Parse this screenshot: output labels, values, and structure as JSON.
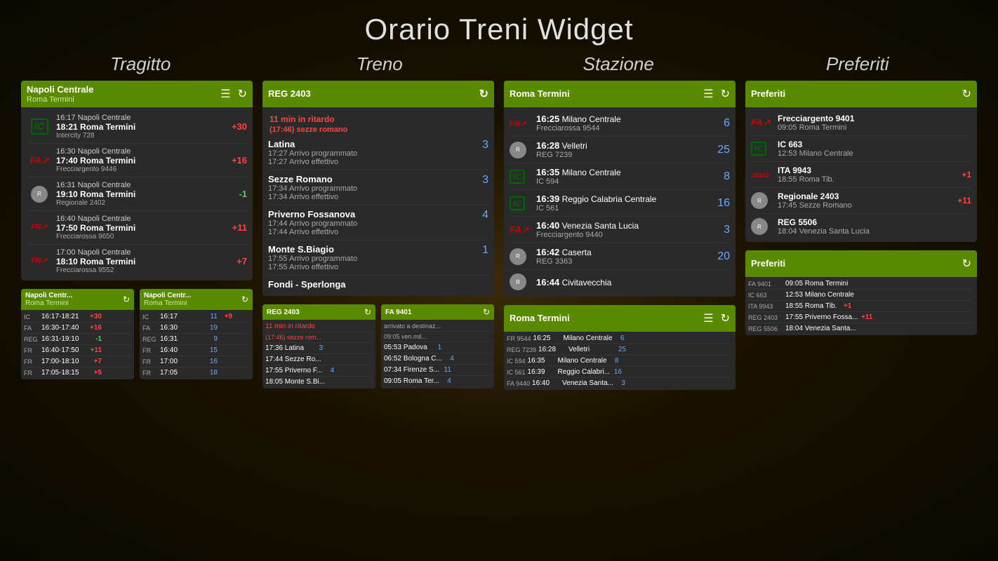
{
  "page": {
    "title": "Orario Treni Widget"
  },
  "columns": [
    {
      "header": "Tragitto"
    },
    {
      "header": "Treno"
    },
    {
      "header": "Stazione"
    },
    {
      "header": "Preferiti"
    }
  ],
  "tragitto": {
    "header": "Napoli Centrale\nRoma Termini",
    "trains": [
      {
        "logo": "IC",
        "from": "16:17 Napoli Centrale",
        "to": "18:21 Roma Termini",
        "name": "Intercity 728",
        "delay": "+30",
        "delayType": "pos"
      },
      {
        "logo": "FA",
        "from": "16:30 Napoli Centrale",
        "to": "17:40 Roma Termini",
        "name": "Frecciargento 9446",
        "delay": "+16",
        "delayType": "pos"
      },
      {
        "logo": "REG",
        "from": "16:31 Napoli Centrale",
        "to": "19:10 Roma Termini",
        "name": "Regionale 2402",
        "delay": "-1",
        "delayType": "neg"
      },
      {
        "logo": "FR",
        "from": "16:40 Napoli Centrale",
        "to": "17:50 Roma Termini",
        "name": "Frecciarossa 9650",
        "delay": "+11",
        "delayType": "pos"
      },
      {
        "logo": "FR",
        "from": "17:00 Napoli Centrale",
        "to": "18:10 Roma Termini",
        "name": "Frecciarossa 9552",
        "delay": "+7",
        "delayType": "pos"
      }
    ]
  },
  "treno": {
    "header": "REG 2403",
    "delay_notice": "11 min in ritardo",
    "delay_detail": "(17:46) sezze romano",
    "stops": [
      {
        "name": "Latina",
        "arr_prog": "17:27 Arrivo programmato",
        "arr_eff": "17:27 Arrivo effettivo",
        "num": "3"
      },
      {
        "name": "Sezze Romano",
        "arr_prog": "17:34 Arrivo programmato",
        "arr_eff": "17:34 Arrivo effettivo",
        "num": "3"
      },
      {
        "name": "Priverno Fossanova",
        "arr_prog": "17:44 Arrivo programmato",
        "arr_eff": "17:44 Arrivo effettivo",
        "num": "4"
      },
      {
        "name": "Monte S.Biagio",
        "arr_prog": "17:55 Arrivo programmato",
        "arr_eff": "17:55 Arrivo effettivo",
        "num": "1"
      },
      {
        "name": "Fondi - Sperlonga",
        "arr_prog": "",
        "arr_eff": "",
        "num": ""
      }
    ]
  },
  "stazione": {
    "header": "Roma Termini",
    "trains": [
      {
        "logo": "FR",
        "time": "16:25",
        "dest": "Milano Centrale",
        "name": "Frecciarossa 9544",
        "num": "6"
      },
      {
        "logo": "REG",
        "time": "16:28",
        "dest": "Velletri",
        "name": "REG 7239",
        "num": "25"
      },
      {
        "logo": "IC",
        "time": "16:35",
        "dest": "Milano Centrale",
        "name": "IC 594",
        "num": "8"
      },
      {
        "logo": "IC",
        "time": "16:39",
        "dest": "Reggio Calabria Centrale",
        "name": "IC 561",
        "num": "16"
      },
      {
        "logo": "FA",
        "time": "16:40",
        "dest": "Venezia Santa Lucia",
        "name": "Frecciargento 9440",
        "num": "3"
      },
      {
        "logo": "REG",
        "time": "16:42",
        "dest": "Caserta",
        "name": "REG 3363",
        "num": "20"
      },
      {
        "logo": "IC",
        "time": "16:44",
        "dest": "Civitavecchia",
        "name": "",
        "num": ""
      }
    ]
  },
  "preferiti": {
    "header": "Preferiti",
    "trains": [
      {
        "logo": "FA",
        "name": "Frecciargento 9401",
        "detail": "09:05 Roma Termini",
        "delay": "",
        "delayType": ""
      },
      {
        "logo": "IC",
        "name": "IC 663",
        "detail": "12:53 Milano Centrale",
        "delay": "",
        "delayType": ""
      },
      {
        "logo": "ITALO",
        "name": "ITA 9943",
        "detail": "18:55 Roma Tib.",
        "delay": "+1",
        "delayType": "pos"
      },
      {
        "logo": "REG",
        "name": "Regionale 2403",
        "detail": "17:45 Sezze Romano",
        "delay": "+11",
        "delayType": "pos"
      },
      {
        "logo": "REG",
        "name": "REG 5506",
        "detail": "18:04 Venezia Santa Lucia",
        "delay": "",
        "delayType": ""
      }
    ]
  },
  "bottom": {
    "tragitto_small1": {
      "header1": "Napoli Centr...",
      "header2": "Roma Termini",
      "rows": [
        {
          "type": "IC",
          "time": "16:17-18:21",
          "delay": "+30",
          "delayType": "pos"
        },
        {
          "type": "FA",
          "time": "16:30-17:40",
          "delay": "+16",
          "delayType": "pos"
        },
        {
          "type": "REG",
          "time": "16:31-19:10",
          "delay": "-1",
          "delayType": "neg"
        },
        {
          "type": "FR",
          "time": "16:40-17:50",
          "delay": "+11",
          "delayType": "pos"
        },
        {
          "type": "FR",
          "time": "17:00-18:10",
          "delay": "+7",
          "delayType": "pos"
        },
        {
          "type": "FR",
          "time": "17:05-18:15",
          "delay": "+5",
          "delayType": "pos"
        }
      ]
    },
    "tragitto_small2": {
      "header1": "Napoli Centr...",
      "header2": "Roma Termini",
      "rows": [
        {
          "type": "IC",
          "time": "16:17",
          "num": "11",
          "delay": "+9",
          "delayType": "pos"
        },
        {
          "type": "FA",
          "time": "16:30",
          "num": "19",
          "delay": "",
          "delayType": ""
        },
        {
          "type": "REG",
          "time": "16:31",
          "num": "9",
          "delay": "",
          "delayType": ""
        },
        {
          "type": "FR",
          "time": "16:40",
          "num": "15",
          "delay": "",
          "delayType": ""
        },
        {
          "type": "FR",
          "time": "17:00",
          "num": "16",
          "delay": "",
          "delayType": ""
        },
        {
          "type": "FR",
          "time": "17:05",
          "num": "18",
          "delay": "",
          "delayType": ""
        }
      ]
    },
    "treno_small1": {
      "header": "REG 2403",
      "delay": "11 min in ritardo",
      "delay2": "(17:46) sezze rom...",
      "stops": [
        {
          "time": "17:36",
          "name": "Latina",
          "num": "3"
        },
        {
          "time": "17:44",
          "name": "Sezze Ro...",
          "num": ""
        },
        {
          "time": "17:55",
          "name": "Priverno F...",
          "num": "4"
        },
        {
          "time": "18:05",
          "name": "Monte S.Bi...",
          "num": ""
        }
      ]
    },
    "treno_small2": {
      "header": "FA 9401",
      "arrived": "arrivato a destinaz...",
      "stops": [
        {
          "time": "05:53",
          "name": "Padova",
          "num": "1"
        },
        {
          "time": "06:52",
          "name": "Bologna C...",
          "num": "4"
        },
        {
          "time": "07:34",
          "name": "Firenze S...",
          "num": "11"
        },
        {
          "time": "09:05",
          "name": "Roma Ter...",
          "num": "4"
        }
      ]
    },
    "stazione_small": {
      "header": "Roma Termini",
      "rows": [
        {
          "type": "FR 9544",
          "time": "16:25",
          "dest": "Milano Centrale",
          "num": "6"
        },
        {
          "type": "REG 7239",
          "time": "16:28",
          "dest": "Velletri",
          "num": "25"
        },
        {
          "type": "IC 594",
          "time": "16:35",
          "dest": "Milano Centrale",
          "num": "8"
        },
        {
          "type": "IC 561",
          "time": "16:39",
          "dest": "Reggio Calabri...",
          "num": "16"
        },
        {
          "type": "FA 9440",
          "time": "16:40",
          "dest": "Venezia Santa...",
          "num": "3"
        }
      ]
    },
    "preferiti_small": {
      "header": "Preferiti",
      "rows": [
        {
          "name": "FA 9401",
          "time": "09:05 Roma Termini",
          "delay": "",
          "delayType": ""
        },
        {
          "name": "IC 663",
          "time": "12:53 Milano Centrale",
          "delay": "",
          "delayType": ""
        },
        {
          "name": "ITA 9943",
          "time": "18:55 Roma Tib.",
          "delay": "+1",
          "delayType": "pos"
        },
        {
          "name": "REG 2403",
          "time": "17:55 Priverno Fossa...",
          "delay": "+11",
          "delayType": "pos"
        },
        {
          "name": "REG 5506",
          "time": "18:04 Venezia Santa...",
          "delay": "",
          "delayType": ""
        }
      ]
    }
  }
}
